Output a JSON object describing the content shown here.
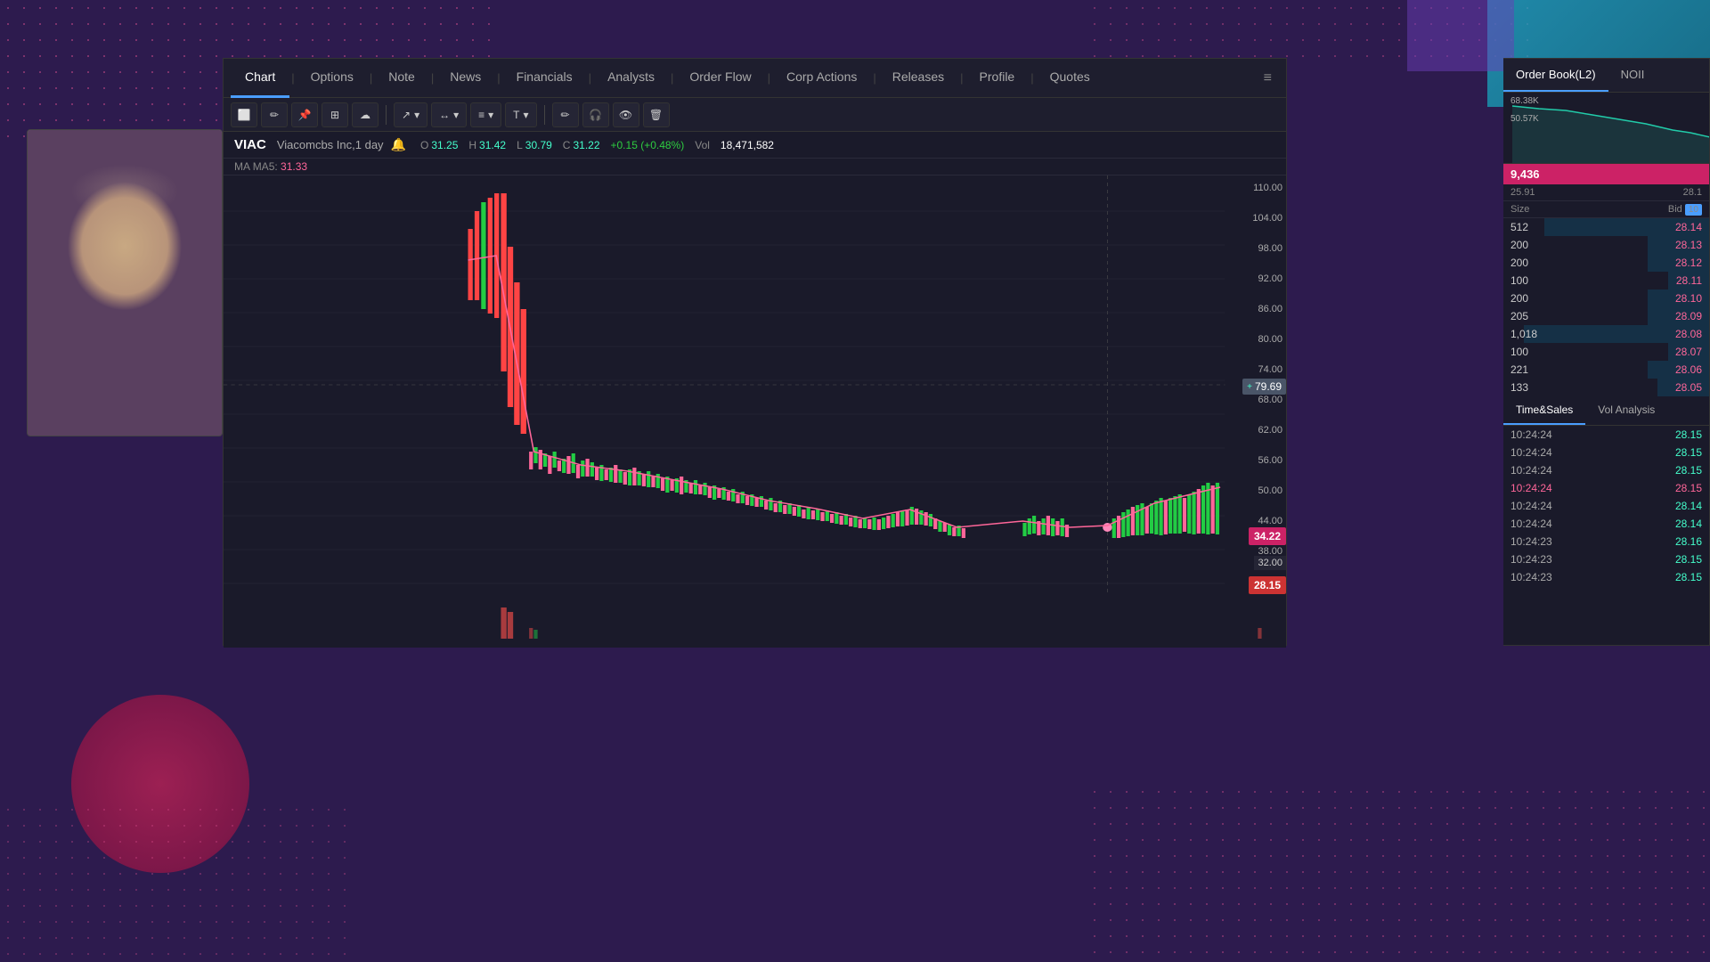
{
  "background": {
    "color": "#2d1b4e"
  },
  "tabs": {
    "items": [
      {
        "label": "Chart",
        "active": true
      },
      {
        "label": "Options",
        "active": false
      },
      {
        "label": "Note",
        "active": false
      },
      {
        "label": "News",
        "active": false
      },
      {
        "label": "Financials",
        "active": false
      },
      {
        "label": "Analysts",
        "active": false
      },
      {
        "label": "Order Flow",
        "active": false
      },
      {
        "label": "Corp Actions",
        "active": false
      },
      {
        "label": "Releases",
        "active": false
      },
      {
        "label": "Profile",
        "active": false
      },
      {
        "label": "Quotes",
        "active": false
      }
    ]
  },
  "toolbar": {
    "icons": [
      "✏️",
      "📌",
      "⊞",
      "☁",
      "↗",
      "↔",
      "≡",
      "T",
      "✏",
      "🎧",
      "👁",
      "🗑"
    ]
  },
  "stock": {
    "symbol": "VIAC",
    "name": "Viacomcbs Inc,1 day",
    "bell": "🔔",
    "open_label": "O",
    "open_value": "31.25",
    "high_label": "H",
    "high_value": "31.42",
    "low_label": "L",
    "low_value": "30.79",
    "close_label": "C",
    "close_value": "31.22",
    "change": "+0.15 (+0.48%)",
    "vol_label": "Vol",
    "vol_value": "18,471,582",
    "ma_label": "MA",
    "ma_name": "MA5:",
    "ma_value": "31.33"
  },
  "price_levels": [
    "110.00",
    "104.00",
    "98.00",
    "92.00",
    "86.00",
    "80.00",
    "74.00",
    "68.00",
    "62.00",
    "56.00",
    "50.00",
    "44.00",
    "38.00",
    "32.00"
  ],
  "crosshair_price": "79.69",
  "current_prices": {
    "badge1": {
      "value": "34.22",
      "style": "pink"
    },
    "badge2": {
      "value": "28.15",
      "style": "red"
    }
  },
  "orderbook": {
    "tab1": "Order Book(L2)",
    "tab2": "NOII",
    "minichart": {
      "level1": "68.38K",
      "level2": "50.57K"
    },
    "current": "9,436",
    "spread_left": "25.91",
    "spread_right": "28.1",
    "header_size": "Size",
    "header_bid": "Bid",
    "header_bid_num": "10",
    "ask_rows": [
      {
        "size": "512",
        "price": "28.14",
        "bar_pct": 80
      },
      {
        "size": "200",
        "price": "28.13",
        "bar_pct": 30
      },
      {
        "size": "200",
        "price": "28.12",
        "bar_pct": 30
      },
      {
        "size": "100",
        "price": "28.11",
        "bar_pct": 20
      },
      {
        "size": "200",
        "price": "28.10",
        "bar_pct": 30
      },
      {
        "size": "205",
        "price": "28.09",
        "bar_pct": 30
      },
      {
        "size": "1,018",
        "price": "28.08",
        "bar_pct": 90
      },
      {
        "size": "100",
        "price": "28.07",
        "bar_pct": 20
      },
      {
        "size": "221",
        "price": "28.06",
        "bar_pct": 30
      },
      {
        "size": "133",
        "price": "28.05",
        "bar_pct": 25
      }
    ]
  },
  "timesales": {
    "tab1": "Time&Sales",
    "tab2": "Vol Analysis",
    "rows": [
      {
        "time": "10:24:24",
        "price": "28.15",
        "pink": false
      },
      {
        "time": "10:24:24",
        "price": "28.15",
        "pink": false
      },
      {
        "time": "10:24:24",
        "price": "28.15",
        "pink": false
      },
      {
        "time": "10:24:24",
        "price": "28.15",
        "pink": true
      },
      {
        "time": "10:24:24",
        "price": "28.14",
        "pink": false
      },
      {
        "time": "10:24:24",
        "price": "28.14",
        "pink": false
      },
      {
        "time": "10:24:23",
        "price": "28.16",
        "pink": false
      },
      {
        "time": "10:24:23",
        "price": "28.15",
        "pink": false
      },
      {
        "time": "10:24:23",
        "price": "28.15",
        "pink": false
      }
    ]
  }
}
